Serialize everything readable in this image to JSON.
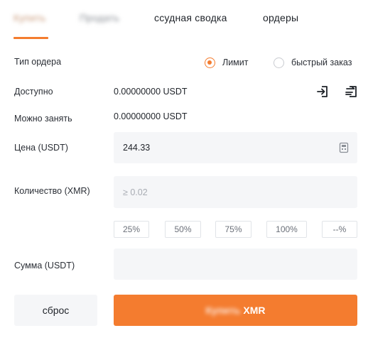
{
  "tabs": [
    {
      "label": "Купить",
      "blurred": true
    },
    {
      "label": "Продать",
      "blurred": true
    },
    {
      "label": "ссудная сводка"
    },
    {
      "label": "ордеры"
    }
  ],
  "order_type": {
    "label": "Тип ордера",
    "options": [
      {
        "label": "Лимит",
        "selected": true
      },
      {
        "label": "быстрый заказ",
        "selected": false
      }
    ]
  },
  "available": {
    "label": "Доступно",
    "value": "0.00000000 USDT"
  },
  "borrowable": {
    "label": "Можно занять",
    "value": "0.00000000 USDT"
  },
  "price": {
    "label": "Цена (USDT)",
    "value": "244.33"
  },
  "quantity": {
    "label": "Количество (XMR)",
    "placeholder": "≥ 0.02"
  },
  "percent_buttons": [
    "25%",
    "50%",
    "75%",
    "100%",
    "--%"
  ],
  "amount": {
    "label": "Сумма (USDT)",
    "value": ""
  },
  "buttons": {
    "reset": "сброс",
    "submit_blurred": "Купить",
    "submit_asset": "XMR"
  },
  "colors": {
    "accent": "#f47c2f",
    "field_bg": "#f5f6f8",
    "text": "#1f2329"
  },
  "icons": {
    "transfer_in": "transfer-in-icon",
    "transfer_out": "transfer-out-icon",
    "calculator": "calculator-icon"
  }
}
